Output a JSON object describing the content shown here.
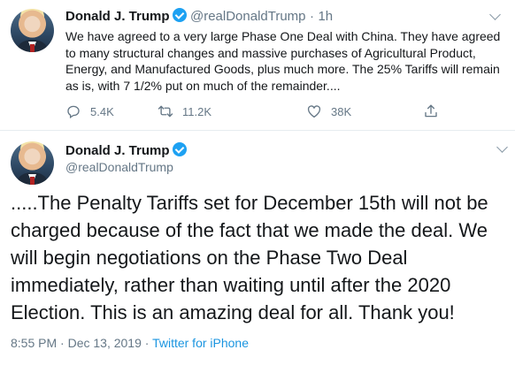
{
  "tweet_1": {
    "author_name": "Donald J. Trump",
    "handle": "@realDonaldTrump",
    "separator": "·",
    "time_ago": "1h",
    "text": "We have agreed to a very large Phase One Deal with China. They have agreed to many structural changes and massive purchases of Agricultural Product, Energy, and Manufactured Goods, plus much more. The 25% Tariffs will remain as is, with 7 1/2% put on much of the remainder....",
    "actions": {
      "reply_count": "5.4K",
      "retweet_count": "11.2K",
      "like_count": "38K"
    }
  },
  "tweet_2": {
    "author_name": "Donald J. Trump",
    "handle": "@realDonaldTrump",
    "text": ".....The Penalty Tariffs set for December 15th will not be charged because of the fact that we made the deal. We will begin negotiations on the Phase Two Deal immediately, rather than waiting until after the 2020 Election. This is an amazing deal for all. Thank you!",
    "timestamp": "8:55 PM · Dec 13, 2019 · ",
    "source": "Twitter for iPhone"
  },
  "colors": {
    "accent": "#1da1f2",
    "secondary_text": "#657786",
    "link": "#1b95e0"
  },
  "icons": [
    "verified-badge-icon",
    "chevron-down-icon",
    "reply-icon",
    "retweet-icon",
    "like-icon",
    "share-icon"
  ]
}
